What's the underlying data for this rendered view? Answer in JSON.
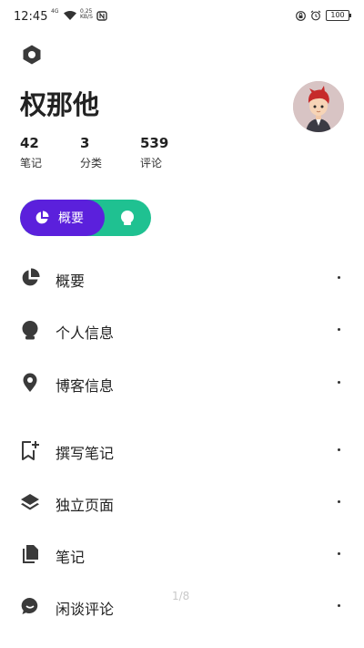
{
  "status_bar": {
    "time": "12:45",
    "signal_text": "4G",
    "speed_value": "0.25",
    "speed_unit": "KB/S",
    "battery": "100"
  },
  "profile": {
    "name": "权那他",
    "stats": [
      {
        "value": "42",
        "label": "笔记"
      },
      {
        "value": "3",
        "label": "分类"
      },
      {
        "value": "539",
        "label": "评论"
      }
    ]
  },
  "toggle": {
    "active_label": "概要"
  },
  "menu": [
    {
      "label": "概要",
      "icon": "pie-chart-icon"
    },
    {
      "label": "个人信息",
      "icon": "person-icon"
    },
    {
      "label": "博客信息",
      "icon": "location-pin-icon"
    },
    {
      "label": "撰写笔记",
      "icon": "bookmark-add-icon"
    },
    {
      "label": "独立页面",
      "icon": "layers-icon"
    },
    {
      "label": "笔记",
      "icon": "files-icon"
    },
    {
      "label": "闲谈评论",
      "icon": "chat-bubble-icon"
    }
  ],
  "page_indicator": "1/8",
  "colors": {
    "accent_purple": "#5b20dc",
    "accent_green": "#1fc191"
  }
}
